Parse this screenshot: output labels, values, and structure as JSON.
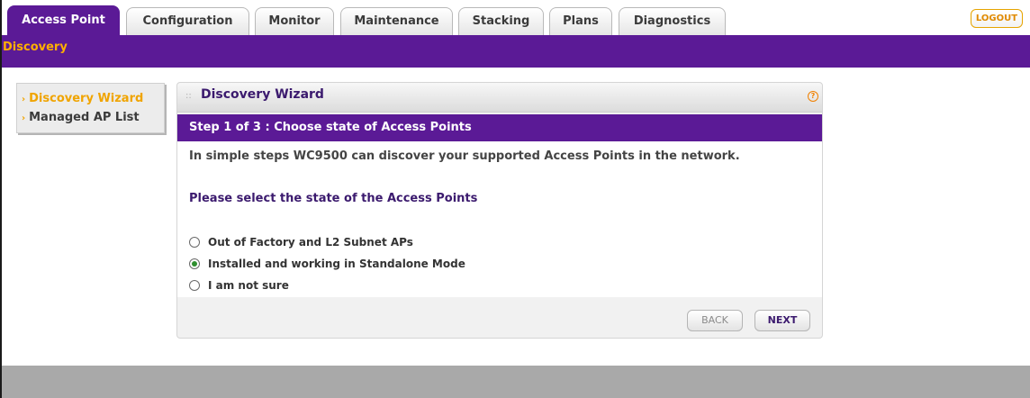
{
  "tabs": [
    {
      "label": "Access Point",
      "active": true
    },
    {
      "label": "Configuration",
      "active": false
    },
    {
      "label": "Monitor",
      "active": false
    },
    {
      "label": "Maintenance",
      "active": false
    },
    {
      "label": "Stacking",
      "active": false
    },
    {
      "label": "Plans",
      "active": false
    },
    {
      "label": "Diagnostics",
      "active": false
    }
  ],
  "logout_label": "LOGOUT",
  "subnav": {
    "item": "Discovery"
  },
  "sidebar": {
    "items": [
      {
        "label": "Discovery Wizard",
        "active": true
      },
      {
        "label": "Managed AP List",
        "active": false
      }
    ]
  },
  "panel": {
    "title": "Discovery Wizard",
    "help_icon": "?",
    "step_title": "Step 1 of 3 : Choose state of Access Points",
    "intro": "In simple steps WC9500 can discover your supported Access Points in the network.",
    "prompt": "Please select the state of the Access Points",
    "options": [
      {
        "label": "Out of Factory and L2 Subnet APs",
        "selected": false
      },
      {
        "label": "Installed and working in Standalone Mode",
        "selected": true
      },
      {
        "label": "I am not sure",
        "selected": false
      }
    ],
    "back_label": "BACK",
    "next_label": "NEXT"
  },
  "colors": {
    "brand_purple": "#5b1a96",
    "accent_orange": "#f0a400",
    "footer_gray": "#a9a9a9"
  }
}
